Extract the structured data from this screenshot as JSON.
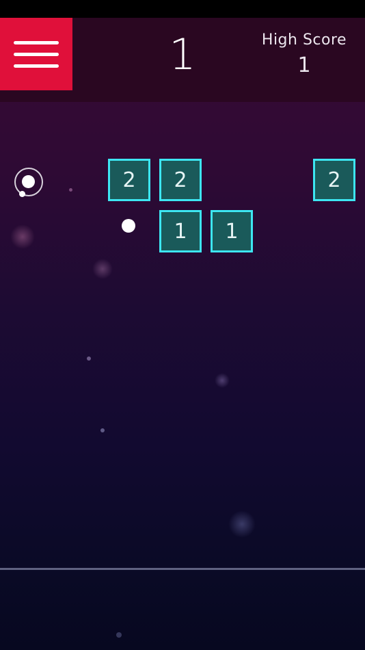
{
  "header": {
    "menu_icon": "hamburger-menu-icon",
    "menu_color": "#e0103a",
    "score": "1",
    "high_score_label": "High Score",
    "high_score": "1"
  },
  "bricks": [
    {
      "row": 1,
      "col": 2,
      "value": "2"
    },
    {
      "row": 1,
      "col": 3,
      "value": "2"
    },
    {
      "row": 1,
      "col": 6,
      "value": "2"
    },
    {
      "row": 2,
      "col": 3,
      "value": "1"
    },
    {
      "row": 2,
      "col": 4,
      "value": "1"
    }
  ],
  "colors": {
    "brick_border": "#3de6f2",
    "brick_fill": "#1a5a5a",
    "background_top": "#3a0a35",
    "background_bottom": "#070820"
  }
}
